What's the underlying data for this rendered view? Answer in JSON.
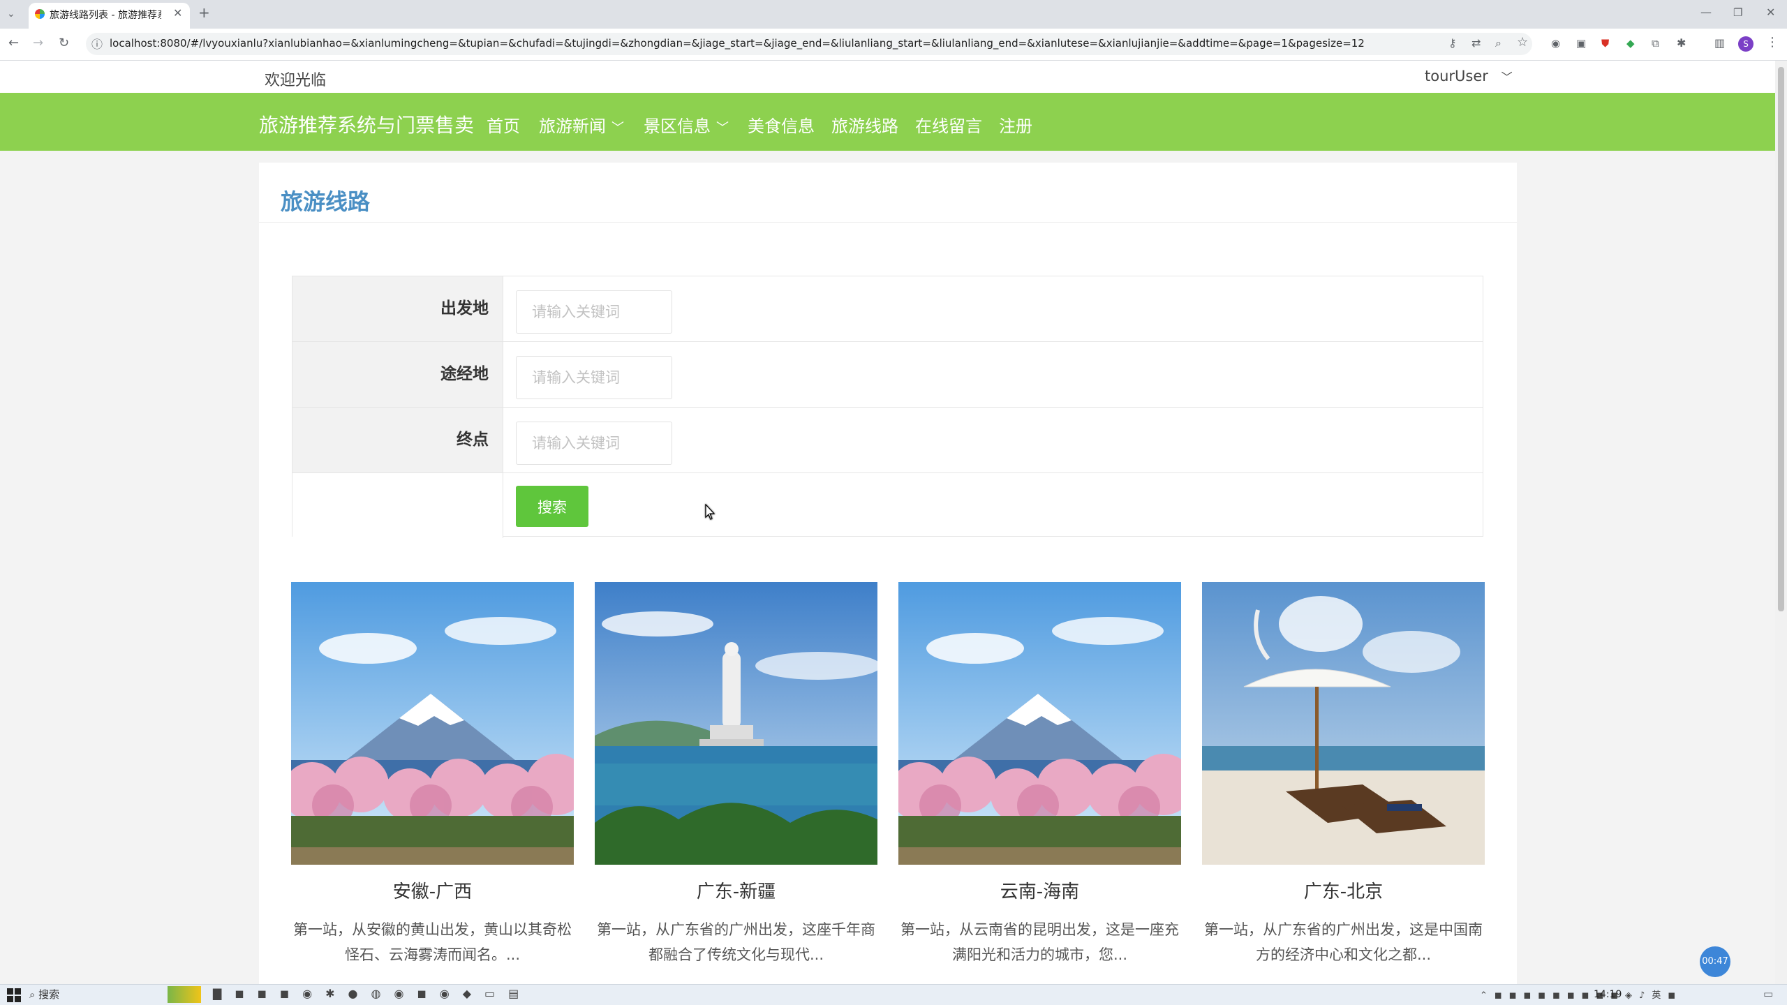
{
  "browser": {
    "tab_title": "旅游线路列表 - 旅游推荐系统与",
    "url": "localhost:8080/#/lvyouxianlu?xianlubianhao=&xianlumingcheng=&tupian=&chufadi=&tujingdi=&zhongdian=&jiage_start=&jiage_end=&liulanliang_start=&liulanliang_end=&xianlutese=&xianlujianjie=&addtime=&page=1&pagesize=12",
    "new_tab": "+",
    "profile_initial": "S"
  },
  "site": {
    "welcome": "欢迎光临",
    "user": "tourUser",
    "title": "旅游推荐系统与门票售卖",
    "nav": [
      {
        "label": "首页"
      },
      {
        "label": "旅游新闻",
        "has_dropdown": true
      },
      {
        "label": "景区信息",
        "has_dropdown": true
      },
      {
        "label": "美食信息"
      },
      {
        "label": "旅游线路"
      },
      {
        "label": "在线留言"
      },
      {
        "label": "注册"
      }
    ],
    "accent_color": "#8dd14f"
  },
  "page": {
    "title": "旅游线路",
    "form": {
      "fields": [
        {
          "label": "出发地",
          "placeholder": "请输入关键词"
        },
        {
          "label": "途经地",
          "placeholder": "请输入关键词"
        },
        {
          "label": "终点",
          "placeholder": "请输入关键词"
        }
      ],
      "search_label": "搜索"
    },
    "cards": [
      {
        "title": "安徽-广西",
        "desc": "第一站，从安徽的黄山出发，黄山以其奇松怪石、云海雾涛而闻名。...",
        "image": "mount-fuji-sakura"
      },
      {
        "title": "广东-新疆",
        "desc": "第一站，从广东省的广州出发，这座千年商都融合了传统文化与现代...",
        "image": "guanyin-statue-sea"
      },
      {
        "title": "云南-海南",
        "desc": "第一站，从云南省的昆明出发，这是一座充满阳光和活力的城市，您...",
        "image": "mount-fuji-sakura"
      },
      {
        "title": "广东-北京",
        "desc": "第一站，从广东省的广州出发，这是中国南方的经济中心和文化之都...",
        "image": "beach-umbrella-loungers"
      }
    ],
    "timer": "00:47"
  },
  "taskbar": {
    "search": "搜索",
    "time": "14:19",
    "lang": "英"
  }
}
